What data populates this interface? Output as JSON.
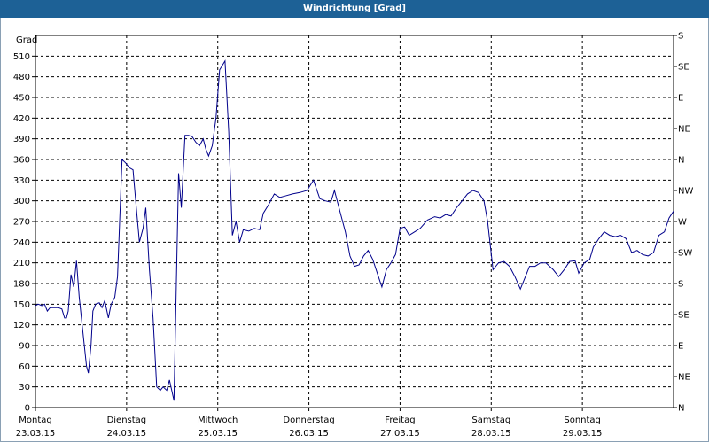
{
  "window": {
    "title": "Windrichtung [Grad]"
  },
  "colors": {
    "title_bar": "#1d6196",
    "series_line": "#00008b",
    "grid": "#000000"
  },
  "chart_data": {
    "type": "line",
    "title": "Windrichtung [Grad]",
    "ylabel": "Grad",
    "ylim": [
      0,
      540
    ],
    "yticks": [
      0,
      30,
      60,
      90,
      120,
      150,
      180,
      210,
      240,
      270,
      300,
      330,
      360,
      390,
      420,
      450,
      480,
      510
    ],
    "right_axis_labels": [
      "N",
      "NE",
      "E",
      "SE",
      "S",
      "SW",
      "W",
      "NW",
      "N",
      "NE",
      "E",
      "SE",
      "S"
    ],
    "xlim": [
      0,
      7
    ],
    "x_ticks": [
      {
        "day": "Montag",
        "date": "23.03.15"
      },
      {
        "day": "Dienstag",
        "date": "24.03.15"
      },
      {
        "day": "Mittwoch",
        "date": "25.03.15"
      },
      {
        "day": "Donnerstag",
        "date": "26.03.15"
      },
      {
        "day": "Freitag",
        "date": "27.03.15"
      },
      {
        "day": "Samstag",
        "date": "28.03.15"
      },
      {
        "day": "Sonntag",
        "date": "29.03.15"
      }
    ],
    "grid": true,
    "series": [
      {
        "values": [
          [
            0.0,
            148
          ],
          [
            0.03,
            150
          ],
          [
            0.07,
            148
          ],
          [
            0.1,
            150
          ],
          [
            0.13,
            140
          ],
          [
            0.16,
            145
          ],
          [
            0.2,
            145
          ],
          [
            0.25,
            145
          ],
          [
            0.29,
            143
          ],
          [
            0.32,
            130
          ],
          [
            0.34,
            130
          ],
          [
            0.36,
            140
          ],
          [
            0.39,
            193
          ],
          [
            0.42,
            175
          ],
          [
            0.45,
            213
          ],
          [
            0.48,
            160
          ],
          [
            0.52,
            110
          ],
          [
            0.56,
            60
          ],
          [
            0.58,
            50
          ],
          [
            0.61,
            90
          ],
          [
            0.63,
            140
          ],
          [
            0.66,
            150
          ],
          [
            0.7,
            152
          ],
          [
            0.73,
            145
          ],
          [
            0.76,
            155
          ],
          [
            0.8,
            130
          ],
          [
            0.83,
            150
          ],
          [
            0.87,
            160
          ],
          [
            0.9,
            190
          ],
          [
            0.95,
            360
          ],
          [
            0.99,
            355
          ],
          [
            1.03,
            348
          ],
          [
            1.07,
            345
          ],
          [
            1.1,
            300
          ],
          [
            1.14,
            240
          ],
          [
            1.18,
            260
          ],
          [
            1.21,
            290
          ],
          [
            1.25,
            200
          ],
          [
            1.29,
            130
          ],
          [
            1.33,
            30
          ],
          [
            1.37,
            25
          ],
          [
            1.4,
            30
          ],
          [
            1.44,
            25
          ],
          [
            1.47,
            40
          ],
          [
            1.52,
            10
          ],
          [
            1.57,
            340
          ],
          [
            1.6,
            290
          ],
          [
            1.64,
            395
          ],
          [
            1.68,
            395
          ],
          [
            1.72,
            393
          ],
          [
            1.76,
            385
          ],
          [
            1.8,
            380
          ],
          [
            1.84,
            390
          ],
          [
            1.87,
            375
          ],
          [
            1.9,
            365
          ],
          [
            1.94,
            380
          ],
          [
            1.98,
            420
          ],
          [
            2.02,
            490
          ],
          [
            2.08,
            503
          ],
          [
            2.12,
            400
          ],
          [
            2.16,
            250
          ],
          [
            2.2,
            270
          ],
          [
            2.24,
            240
          ],
          [
            2.28,
            258
          ],
          [
            2.34,
            256
          ],
          [
            2.4,
            260
          ],
          [
            2.46,
            258
          ],
          [
            2.5,
            282
          ],
          [
            2.56,
            295
          ],
          [
            2.62,
            310
          ],
          [
            2.68,
            305
          ],
          [
            2.74,
            307
          ],
          [
            2.82,
            310
          ],
          [
            2.9,
            312
          ],
          [
            2.98,
            315
          ],
          [
            3.05,
            330
          ],
          [
            3.12,
            303
          ],
          [
            3.18,
            300
          ],
          [
            3.24,
            298
          ],
          [
            3.28,
            315
          ],
          [
            3.34,
            285
          ],
          [
            3.4,
            255
          ],
          [
            3.45,
            220
          ],
          [
            3.5,
            205
          ],
          [
            3.55,
            207
          ],
          [
            3.6,
            220
          ],
          [
            3.65,
            228
          ],
          [
            3.7,
            215
          ],
          [
            3.75,
            195
          ],
          [
            3.8,
            175
          ],
          [
            3.85,
            200
          ],
          [
            3.9,
            210
          ],
          [
            3.95,
            222
          ],
          [
            4.0,
            260
          ],
          [
            4.05,
            262
          ],
          [
            4.1,
            250
          ],
          [
            4.16,
            255
          ],
          [
            4.22,
            260
          ],
          [
            4.3,
            272
          ],
          [
            4.38,
            277
          ],
          [
            4.44,
            275
          ],
          [
            4.5,
            280
          ],
          [
            4.56,
            278
          ],
          [
            4.62,
            290
          ],
          [
            4.68,
            300
          ],
          [
            4.74,
            310
          ],
          [
            4.8,
            315
          ],
          [
            4.86,
            312
          ],
          [
            4.92,
            300
          ],
          [
            4.96,
            270
          ],
          [
            5.02,
            200
          ],
          [
            5.08,
            210
          ],
          [
            5.14,
            212
          ],
          [
            5.2,
            205
          ],
          [
            5.26,
            190
          ],
          [
            5.32,
            172
          ],
          [
            5.36,
            185
          ],
          [
            5.42,
            205
          ],
          [
            5.48,
            205
          ],
          [
            5.54,
            210
          ],
          [
            5.6,
            210
          ],
          [
            5.68,
            200
          ],
          [
            5.74,
            190
          ],
          [
            5.8,
            200
          ],
          [
            5.86,
            212
          ],
          [
            5.92,
            213
          ],
          [
            5.96,
            195
          ],
          [
            6.02,
            210
          ],
          [
            6.08,
            215
          ],
          [
            6.12,
            233
          ],
          [
            6.18,
            245
          ],
          [
            6.24,
            255
          ],
          [
            6.3,
            250
          ],
          [
            6.36,
            248
          ],
          [
            6.42,
            250
          ],
          [
            6.48,
            245
          ],
          [
            6.54,
            225
          ],
          [
            6.6,
            228
          ],
          [
            6.66,
            222
          ],
          [
            6.72,
            220
          ],
          [
            6.78,
            225
          ],
          [
            6.84,
            250
          ],
          [
            6.9,
            255
          ],
          [
            6.95,
            275
          ],
          [
            7.0,
            285
          ]
        ]
      }
    ]
  }
}
